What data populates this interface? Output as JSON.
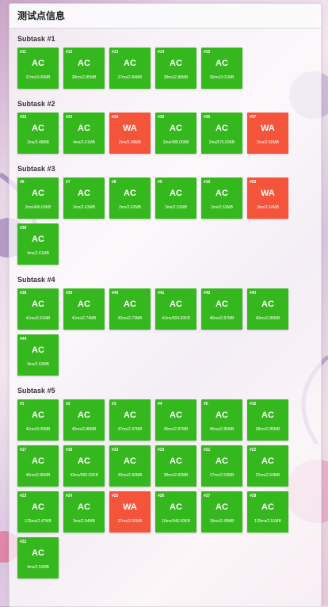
{
  "panel": {
    "title": "测试点信息"
  },
  "colors": {
    "ac": "#35b81d",
    "wa": "#f3543a"
  },
  "subtasks": [
    {
      "title": "Subtask #1",
      "cases": [
        {
          "id": "#11",
          "status": "AC",
          "info": "37ms/3.00MB"
        },
        {
          "id": "#12",
          "status": "AC",
          "info": "38ms/2.85MB"
        },
        {
          "id": "#13",
          "status": "AC",
          "info": "37ms/2.84MB"
        },
        {
          "id": "#14",
          "status": "AC",
          "info": "38ms/2.88MB"
        },
        {
          "id": "#15",
          "status": "AC",
          "info": "36ms/3.01MB"
        }
      ]
    },
    {
      "title": "Subtask #2",
      "cases": [
        {
          "id": "#32",
          "status": "AC",
          "info": "2ms/2.48MB"
        },
        {
          "id": "#33",
          "status": "AC",
          "info": "4ms/2.61MB"
        },
        {
          "id": "#34",
          "status": "WA",
          "info": "2ms/2.49MB"
        },
        {
          "id": "#35",
          "status": "AC",
          "info": "2ms/488.00KB"
        },
        {
          "id": "#36",
          "status": "AC",
          "info": "2ms/576.00KB"
        },
        {
          "id": "#37",
          "status": "WA",
          "info": "2ms/2.50MB"
        }
      ]
    },
    {
      "title": "Subtask #3",
      "cases": [
        {
          "id": "#6",
          "status": "AC",
          "info": "2ms/496.00KB"
        },
        {
          "id": "#7",
          "status": "AC",
          "info": "2ms/2.63MB"
        },
        {
          "id": "#8",
          "status": "AC",
          "info": "2ms/2.62MB"
        },
        {
          "id": "#9",
          "status": "AC",
          "info": "2ms/2.52MB"
        },
        {
          "id": "#10",
          "status": "AC",
          "info": "2ms/2.63MB"
        },
        {
          "id": "#29",
          "status": "WA",
          "info": "3ms/2.64MB"
        },
        {
          "id": "#30",
          "status": "AC",
          "info": "4ms/2.61MB"
        }
      ]
    },
    {
      "title": "Subtask #4",
      "cases": [
        {
          "id": "#38",
          "status": "AC",
          "info": "41ms/2.61MB"
        },
        {
          "id": "#39",
          "status": "AC",
          "info": "41ms/2.74MB"
        },
        {
          "id": "#40",
          "status": "AC",
          "info": "42ms/2.73MB"
        },
        {
          "id": "#41",
          "status": "AC",
          "info": "41ms/504.00KB"
        },
        {
          "id": "#42",
          "status": "AC",
          "info": "40ms/2.87MB"
        },
        {
          "id": "#43",
          "status": "AC",
          "info": "40ms/2.85MB"
        },
        {
          "id": "#44",
          "status": "AC",
          "info": "3ms/2.63MB"
        }
      ]
    },
    {
      "title": "Subtask #5",
      "cases": [
        {
          "id": "#1",
          "status": "AC",
          "info": "41ms/3.00MB"
        },
        {
          "id": "#2",
          "status": "AC",
          "info": "45ms/2.88MB"
        },
        {
          "id": "#3",
          "status": "AC",
          "info": "47ms/2.97MB"
        },
        {
          "id": "#4",
          "status": "AC",
          "info": "45ms/2.87MB"
        },
        {
          "id": "#5",
          "status": "AC",
          "info": "45ms/2.85MB"
        },
        {
          "id": "#16",
          "status": "AC",
          "info": "38ms/2.85MB"
        },
        {
          "id": "#17",
          "status": "AC",
          "info": "40ms/2.86MB"
        },
        {
          "id": "#18",
          "status": "AC",
          "info": "43ms/960.00KB"
        },
        {
          "id": "#19",
          "status": "AC",
          "info": "43ms/2.83MB"
        },
        {
          "id": "#20",
          "status": "AC",
          "info": "38ms/2.82MB"
        },
        {
          "id": "#21",
          "status": "AC",
          "info": "17ms/2.53MB"
        },
        {
          "id": "#22",
          "status": "AC",
          "info": "22ms/2.54MB"
        },
        {
          "id": "#23",
          "status": "AC",
          "info": "125ms/2.47MB"
        },
        {
          "id": "#24",
          "status": "AC",
          "info": "3ms/2.54MB"
        },
        {
          "id": "#25",
          "status": "WA",
          "info": "37ms/2.55MB"
        },
        {
          "id": "#26",
          "status": "AC",
          "info": "18ms/640.00KB"
        },
        {
          "id": "#27",
          "status": "AC",
          "info": "18ms/2.49MB"
        },
        {
          "id": "#28",
          "status": "AC",
          "info": "135ms/2.51MB"
        },
        {
          "id": "#31",
          "status": "AC",
          "info": "4ms/2.50MB"
        }
      ]
    }
  ]
}
